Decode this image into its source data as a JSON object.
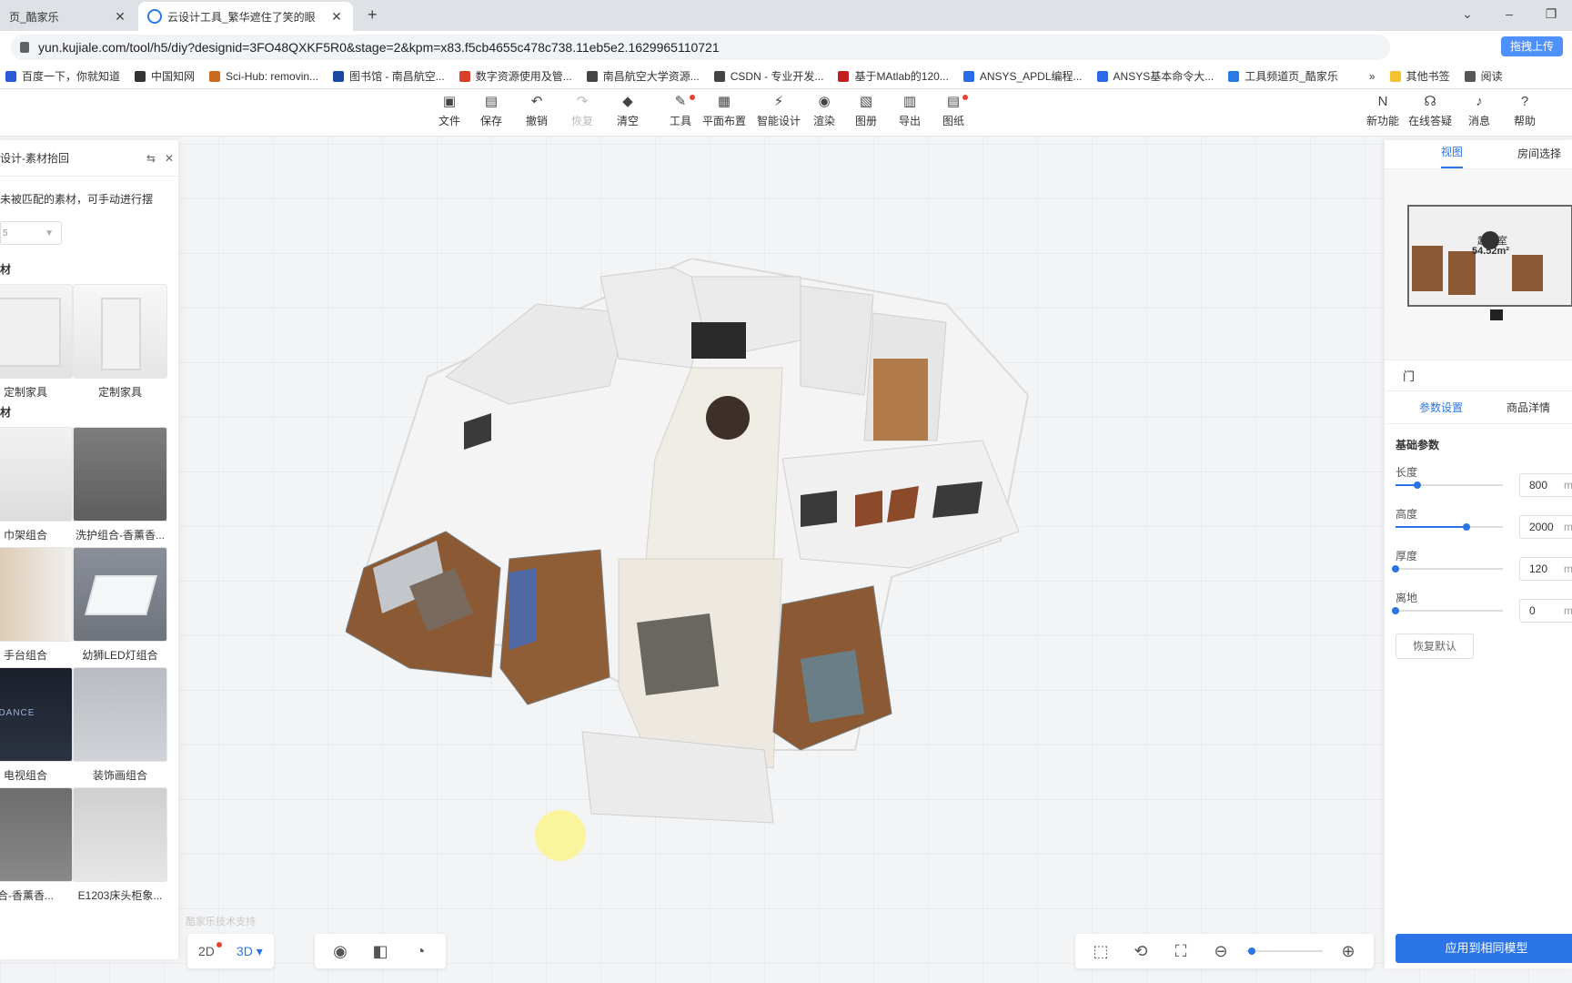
{
  "browser": {
    "tabs": [
      {
        "title": "页_酷家乐",
        "active": false
      },
      {
        "title": "云设计工具_繁华遮住了笑的眼",
        "active": true
      }
    ],
    "new_tab": "+",
    "url": "yun.kujiale.com/tool/h5/diy?designid=3FO48QXKF5R0&stage=2&kpm=x83.f5cb4655c478c738.11eb5e2.1629965110721",
    "upload_button": "拖拽上传",
    "bookmarks": [
      {
        "label": "百度一下，你就知道",
        "color": "#2a5bd7"
      },
      {
        "label": "中国知网",
        "color": "#333333"
      },
      {
        "label": "Sci-Hub: removin...",
        "color": "#c86a1f"
      },
      {
        "label": "图书馆 - 南昌航空...",
        "color": "#1a4aa0"
      },
      {
        "label": "数字资源使用及管...",
        "color": "#d8402c"
      },
      {
        "label": "南昌航空大学资源...",
        "color": "#444444"
      },
      {
        "label": "CSDN - 专业开发...",
        "color": "#444444"
      },
      {
        "label": "基于MAtlab的120...",
        "color": "#c02020"
      },
      {
        "label": "ANSYS_APDL编程...",
        "color": "#2a6ae8"
      },
      {
        "label": "ANSYS基本命令大...",
        "color": "#2a6ae8"
      },
      {
        "label": "工具频道页_酷家乐",
        "color": "#2a7ae2"
      },
      {
        "label": "»",
        "color": "#ffffff"
      },
      {
        "label": "其他书签",
        "color": "#f2c230"
      },
      {
        "label": "阅读",
        "color": "#555555"
      }
    ]
  },
  "toolbar": {
    "items": [
      {
        "label": "文件",
        "icon": "file-icon",
        "glyph": "▣",
        "disabled": false,
        "dot": false
      },
      {
        "label": "保存",
        "icon": "save-icon",
        "glyph": "▤",
        "disabled": false,
        "dot": false
      },
      {
        "label": "撤销",
        "icon": "undo-icon",
        "glyph": "↶",
        "disabled": false,
        "dot": false
      },
      {
        "label": "恢复",
        "icon": "redo-icon",
        "glyph": "↷",
        "disabled": true,
        "dot": false
      },
      {
        "label": "清空",
        "icon": "eraser-icon",
        "glyph": "◆",
        "disabled": false,
        "dot": false
      },
      {
        "label": "工具",
        "icon": "wrench-icon",
        "glyph": "✎",
        "disabled": false,
        "dot": true
      },
      {
        "label": "平面布置",
        "icon": "layout-icon",
        "glyph": "▦",
        "disabled": false,
        "dot": false
      },
      {
        "label": "智能设计",
        "icon": "lightning-icon",
        "glyph": "⚡",
        "disabled": false,
        "dot": false
      },
      {
        "label": "渲染",
        "icon": "camera-icon",
        "glyph": "◉",
        "disabled": false,
        "dot": false
      },
      {
        "label": "图册",
        "icon": "album-icon",
        "glyph": "▧",
        "disabled": false,
        "dot": false
      },
      {
        "label": "导出",
        "icon": "export-icon",
        "glyph": "▥",
        "disabled": false,
        "dot": false
      },
      {
        "label": "图纸",
        "icon": "drawing-icon",
        "glyph": "▤",
        "disabled": false,
        "dot": true
      }
    ],
    "right_items": [
      {
        "label": "新功能",
        "icon": "new-feature-icon",
        "glyph": "N"
      },
      {
        "label": "在线答疑",
        "icon": "headset-icon",
        "glyph": "☊"
      },
      {
        "label": "消息",
        "icon": "bell-icon",
        "glyph": "♪"
      },
      {
        "label": "帮助",
        "icon": "help-icon",
        "glyph": "?"
      }
    ]
  },
  "left_panel": {
    "title": "设计-素材抬回",
    "description": "未被匹配的素材，可手动进行摆",
    "select_value": "5",
    "section1": "材",
    "section2": "材",
    "items_top": [
      {
        "caption": "定制家具"
      },
      {
        "caption": "定制家具"
      }
    ],
    "items": [
      {
        "caption": "巾架组合"
      },
      {
        "caption": "洗护组合-香薰香..."
      },
      {
        "caption": "手台组合"
      },
      {
        "caption": "幼狮LED灯组合"
      },
      {
        "caption": "电视组合"
      },
      {
        "caption": "装饰画组合"
      },
      {
        "caption": "合-香薰香..."
      },
      {
        "caption": "E1203床头柜象..."
      }
    ],
    "tv_text": "KIDANCE"
  },
  "right_panel": {
    "tabs": [
      "视图",
      "房间选择"
    ],
    "minimap_label": "起居室",
    "minimap_area": "54.52m²",
    "section_title": "门",
    "subtabs": [
      "参数设置",
      "商品洋情"
    ],
    "group_title": "基础参数",
    "params": [
      {
        "label": "长度",
        "value": "800",
        "unit": "m",
        "level": 0.2
      },
      {
        "label": "高度",
        "value": "2000",
        "unit": "m",
        "level": 0.66
      },
      {
        "label": "厚度",
        "value": "120",
        "unit": "m",
        "level": 0.0
      },
      {
        "label": "离地",
        "value": "0",
        "unit": "m",
        "level": 0.0
      }
    ],
    "restore_button": "恢复默认",
    "apply_button": "应用到相同模型"
  },
  "bottom": {
    "view_2d": "2D",
    "view_3d": "3D",
    "watermark": "酷家乐技术支持"
  }
}
